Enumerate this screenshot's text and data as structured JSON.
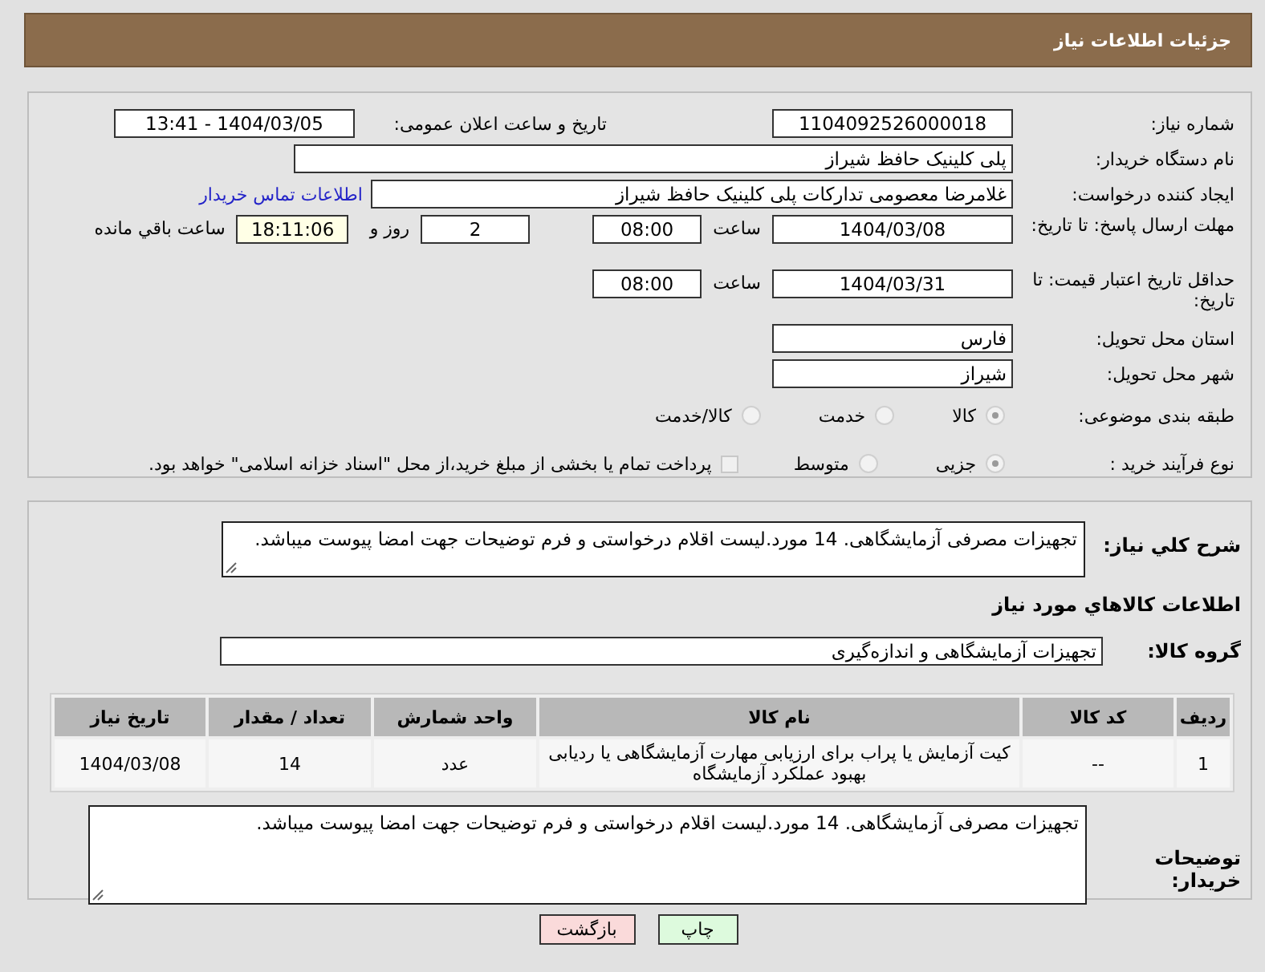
{
  "header": {
    "title": "جزئیات اطلاعات نیاز"
  },
  "need_number": {
    "label": "شماره نیاز:",
    "value": "1104092526000018"
  },
  "announce": {
    "label": "تاریخ و ساعت اعلان عمومی:",
    "value": "1404/03/05 - 13:41"
  },
  "buyer_org": {
    "label": "نام دستگاه خریدار:",
    "value": "پلی کلینیک حافظ شیراز"
  },
  "creator": {
    "label": "ایجاد کننده درخواست:",
    "value": "غلامرضا معصومی تدارکات پلی کلینیک حافظ شیراز",
    "link": "اطلاعات تماس خریدار"
  },
  "reply_deadline": {
    "label": "مهلت ارسال پاسخ: تا تاریخ:",
    "date": "1404/03/08",
    "time_label": "ساعت",
    "time": "08:00",
    "days": "2",
    "days_label": "روز و",
    "remaining": "18:11:06",
    "remaining_label": "ساعت باقي مانده"
  },
  "price_validity": {
    "label": "حداقل تاریخ اعتبار قیمت: تا تاریخ:",
    "date": "1404/03/31",
    "time_label": "ساعت",
    "time": "08:00"
  },
  "province": {
    "label": "استان محل تحویل:",
    "value": "فارس"
  },
  "city": {
    "label": "شهر محل تحویل:",
    "value": "شیراز"
  },
  "category": {
    "label": "طبقه بندی موضوعی:",
    "options": [
      {
        "label": "کالا",
        "selected": true
      },
      {
        "label": "خدمت",
        "selected": false
      },
      {
        "label": "کالا/خدمت",
        "selected": false
      }
    ]
  },
  "process": {
    "label": "نوع فرآیند خرید :",
    "options": [
      {
        "label": "جزیی",
        "selected": true
      },
      {
        "label": "متوسط",
        "selected": false
      }
    ],
    "payment": {
      "label": "پرداخت تمام یا بخشی از مبلغ خرید،از محل \"اسناد خزانه اسلامی\" خواهد بود.",
      "checked": false
    }
  },
  "summary": {
    "label": "شرح کلي نياز:",
    "value": "تجهیزات مصرفی آزمایشگاهی. 14 مورد.لیست اقلام درخواستی و فرم توضیحات جهت امضا پیوست میباشد."
  },
  "goods_heading": "اطلاعات کالاهاي مورد نياز",
  "goods_group": {
    "label": "گروه کالا:",
    "value": "تجهیزات آزمایشگاهی و اندازه‌گیری"
  },
  "table": {
    "columns": [
      "رديف",
      "کد کالا",
      "نام کالا",
      "واحد شمارش",
      "تعداد / مقدار",
      "تاريخ نياز"
    ],
    "rows": [
      {
        "cells": [
          "1",
          "--",
          "کیت آزمایش یا پراب برای ارزیابی مهارت آزمایشگاهی یا ردیابی بهبود عملکرد آزمایشگاه",
          "عدد",
          "14",
          "1404/03/08"
        ]
      }
    ]
  },
  "buyer_notes": {
    "label": "توضیحات خریدار:",
    "value": "تجهیزات مصرفی آزمایشگاهی. 14 مورد.لیست اقلام درخواستی و فرم توضیحات جهت امضا پیوست میباشد."
  },
  "buttons": [
    {
      "kind": "print",
      "label": "چاپ"
    },
    {
      "kind": "back",
      "label": "بازگشت"
    }
  ]
}
